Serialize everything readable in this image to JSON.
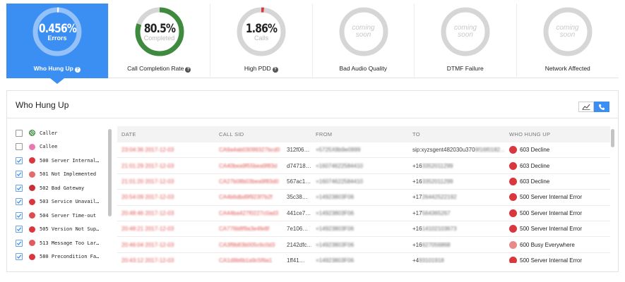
{
  "metrics": [
    {
      "id": "who-hung-up",
      "value": "0.456%",
      "sub": "Errors",
      "label": "Who Hung Up",
      "help": true,
      "active": true,
      "coming_soon": false,
      "progress": 0.00456,
      "color": "#ffffff"
    },
    {
      "id": "call-completion",
      "value": "80.5%",
      "sub": "Completed",
      "label": "Call Completion Rate",
      "help": true,
      "active": false,
      "coming_soon": false,
      "progress": 0.805,
      "color": "#3e8a3e"
    },
    {
      "id": "high-pdd",
      "value": "1.86%",
      "sub": "Calls",
      "label": "High PDD",
      "help": true,
      "active": false,
      "coming_soon": false,
      "progress": 0.0186,
      "color": "#d9363e"
    },
    {
      "id": "bad-audio",
      "value": "coming soon",
      "label": "Bad Audio Quality",
      "help": false,
      "active": false,
      "coming_soon": true
    },
    {
      "id": "dtmf",
      "value": "coming soon",
      "label": "DTMF Failure",
      "help": false,
      "active": false,
      "coming_soon": true
    },
    {
      "id": "network",
      "value": "coming soon",
      "label": "Network Affected",
      "help": false,
      "active": false,
      "coming_soon": true
    }
  ],
  "help_glyph": "?",
  "panel": {
    "title": "Who Hung Up",
    "views": [
      {
        "name": "line-chart-view",
        "active": false
      },
      {
        "name": "phone-list-view",
        "active": true
      }
    ]
  },
  "legend": [
    {
      "label": "Caller",
      "checked": false,
      "color": "#3a8a3a",
      "hatched": true
    },
    {
      "label": "Callee",
      "checked": false,
      "color": "#e879b3",
      "hatched": false
    },
    {
      "label": "500 Server Internal…",
      "checked": true,
      "color": "#d9363e",
      "hatched": false
    },
    {
      "label": "501 Not Implemented",
      "checked": true,
      "color": "#e46b6b",
      "hatched": false
    },
    {
      "label": "502 Bad Gateway",
      "checked": true,
      "color": "#c7303a",
      "hatched": false
    },
    {
      "label": "503 Service Unavail…",
      "checked": true,
      "color": "#d9363e",
      "hatched": false
    },
    {
      "label": "504 Server Time-out",
      "checked": true,
      "color": "#dd4a4f",
      "hatched": false
    },
    {
      "label": "505 Version Not Sup…",
      "checked": true,
      "color": "#d9363e",
      "hatched": false
    },
    {
      "label": "513 Message Too Lar…",
      "checked": true,
      "color": "#e05a5f",
      "hatched": false
    },
    {
      "label": "580 Precondition Fa…",
      "checked": true,
      "color": "#d9363e",
      "hatched": false
    }
  ],
  "table": {
    "headers": [
      "DATE",
      "CALL SID",
      "FROM",
      "TO",
      "WHO HUNG UP"
    ],
    "rows": [
      {
        "date": "23:04:36 2017-12-03",
        "sid_hidden": "CA9a4ab03099327bcd0",
        "sid_visible": "312f06…",
        "from": "+5725X8b9e0999",
        "to_hidden": "sip:xyzsgent482030u370",
        "to_visible": "9f16f0182…",
        "hung": "603 Decline",
        "hung_color": "#d9363e"
      },
      {
        "date": "21:01:29 2017-12-03",
        "sid_hidden": "CA40bea9f55bea9f83d",
        "sid_visible": "d74718…",
        "from": "+16074622584410",
        "to_hidden": "+16",
        "to_visible": "3352011299",
        "hung": "603 Decline",
        "hung_color": "#d9363e"
      },
      {
        "date": "21:01:20 2017-12-03",
        "sid_hidden": "CA27b08b03bea9f83d0",
        "sid_visible": "567ac1…",
        "from": "+16074622584410",
        "to_hidden": "+16",
        "to_visible": "3352011299",
        "hung": "603 Decline",
        "hung_color": "#d9363e"
      },
      {
        "date": "20:54:09 2017-12-03",
        "sid_hidden": "CA4b6dbd9f923f7b2f",
        "sid_visible": "35c38…",
        "from": "+14923803F06",
        "to_hidden": "+17",
        "to_visible": "26442522192",
        "hung": "500 Server Internal Error",
        "hung_color": "#d9363e"
      },
      {
        "date": "20:48:46 2017-12-03",
        "sid_hidden": "CA44ba427f0227c0ad3",
        "sid_visible": "441ce7…",
        "from": "+14923803F06",
        "to_hidden": "+17",
        "to_visible": "564365267",
        "hung": "500 Server Internal Error",
        "hung_color": "#d9363e"
      },
      {
        "date": "20:48:21 2017-12-03",
        "sid_hidden": "CA776b8f9a3e4fe8f",
        "sid_visible": "7e106…",
        "from": "+14923803F06",
        "to_hidden": "+16",
        "to_visible": "14102103673",
        "hung": "500 Server Internal Error",
        "hung_color": "#d9363e"
      },
      {
        "date": "20:46:04 2017-12-03",
        "sid_hidden": "CA3f9b83b005c6c0d3",
        "sid_visible": "2142dfc…",
        "from": "+14923803F06",
        "to_hidden": "+16",
        "to_visible": "627056868",
        "hung": "600 Busy Everywhere",
        "hung_color": "#e88a8a"
      },
      {
        "date": "20:43:12 2017-12-03",
        "sid_hidden": "CA1d9b6b1a9c5f6a1",
        "sid_visible": "1ff41…",
        "from": "+14923803F06",
        "to_hidden": "+4",
        "to_visible": "93101918",
        "hung": "500 Server Internal Error",
        "hung_color": "#d9363e"
      }
    ]
  },
  "colors": {
    "accent": "#3b8ef2",
    "gauge_track": "#d6d6d6",
    "error_red": "#d9363e",
    "date_red": "#e05252"
  }
}
